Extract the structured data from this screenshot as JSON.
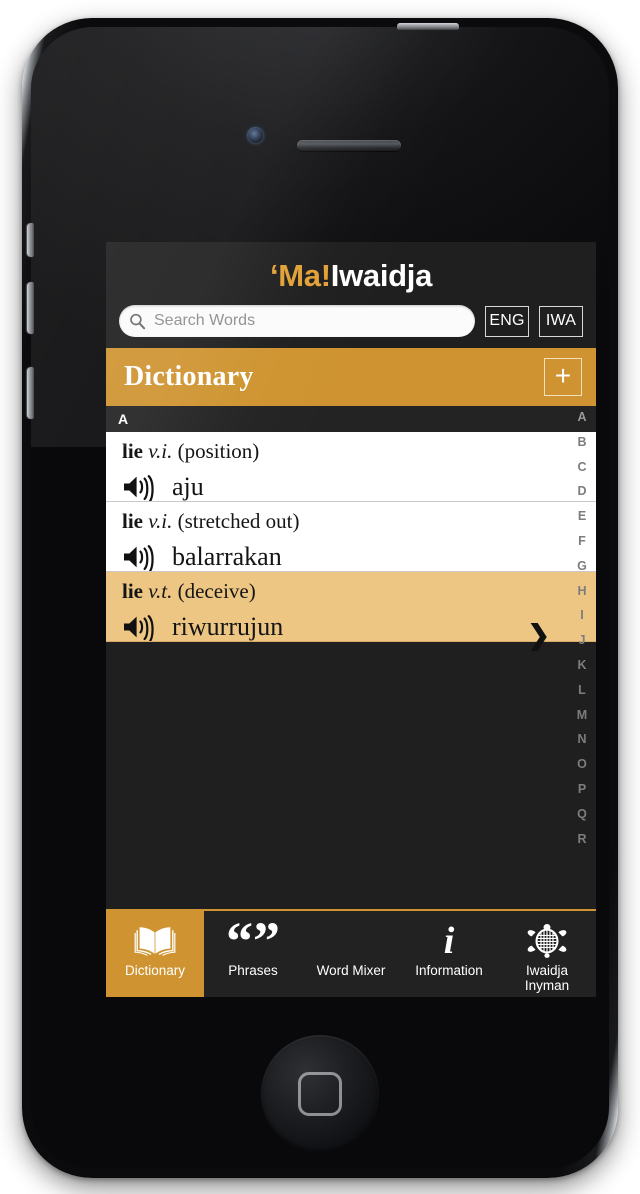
{
  "app": {
    "title_accent": "‘Ma̦",
    "title_accent_display": "‘Ma!",
    "title_rest": "Iwaidja"
  },
  "search": {
    "placeholder": "Search Words",
    "value": "",
    "icon": "search-icon"
  },
  "lang_toggle": {
    "eng": "ENG",
    "iwa": "IWA"
  },
  "navbar": {
    "title": "Dictionary",
    "add_label": "+"
  },
  "list": {
    "section_letter": "A",
    "entries": [
      {
        "headword": "lie",
        "pos": "v.i.",
        "sense": "(position)",
        "word": "aju",
        "selected": false,
        "chevron": ""
      },
      {
        "headword": "lie",
        "pos": "v.i.",
        "sense": "(stretched out)",
        "word": "balarrakan",
        "selected": false,
        "chevron": ""
      },
      {
        "headword": "lie",
        "pos": "v.t.",
        "sense": "(deceive)",
        "word": "riwurrujun",
        "selected": true,
        "chevron": "❯"
      }
    ]
  },
  "alphabet_index": [
    "A",
    "B",
    "C",
    "D",
    "E",
    "F",
    "G",
    "H",
    "I",
    "J",
    "K",
    "L",
    "M",
    "N",
    "O",
    "P",
    "Q",
    "R"
  ],
  "tabs": [
    {
      "label": "Dictionary",
      "icon": "open-book-icon",
      "active": true
    },
    {
      "label": "Phrases",
      "icon": "quotation-marks-icon",
      "active": false
    },
    {
      "label": "Word Mixer",
      "icon": "word-mixer-icon",
      "active": false
    },
    {
      "label": "Information",
      "icon": "info-i-icon",
      "active": false
    },
    {
      "label": "Iwaidja\nInyman",
      "label_line1": "Iwaidja",
      "label_line2": "Inyman",
      "icon": "turtle-icon",
      "active": false
    }
  ],
  "colors": {
    "accent_orange": "#cf9431",
    "selected_row": "#edc684",
    "screen_dark": "#1f1f1f",
    "tabbar_dark": "#222222"
  }
}
